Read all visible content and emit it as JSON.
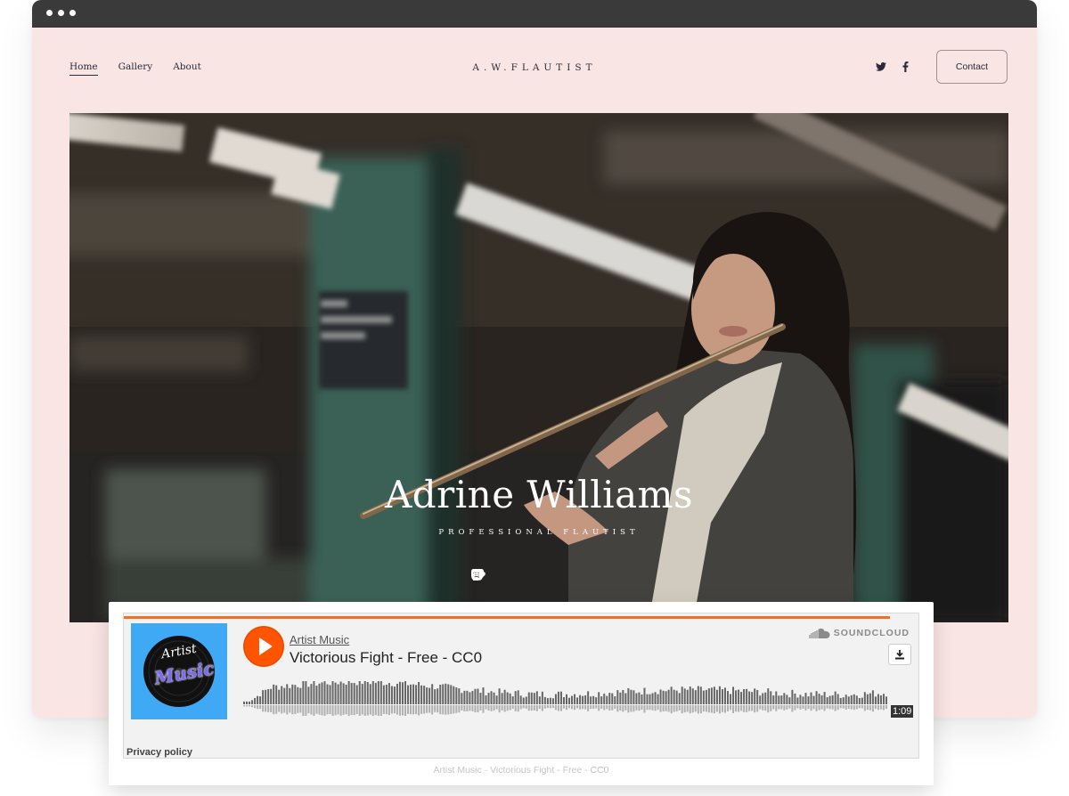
{
  "browser": {
    "dots": 3
  },
  "nav": {
    "items": [
      {
        "label": "Home"
      },
      {
        "label": "Gallery"
      },
      {
        "label": "About"
      }
    ]
  },
  "logo": "A.W.FLAUTIST",
  "header": {
    "contact_label": "Contact",
    "social_icons": [
      "twitter-icon",
      "facebook-icon"
    ]
  },
  "hero": {
    "title": "Adrine Williams",
    "subtitle": "PROFESSIONAL FLAUTIST",
    "social_icons": [
      "facebook-icon",
      "youtube-icon",
      "instagram-icon",
      "spotify-icon",
      "soundcloud-icon"
    ]
  },
  "player": {
    "artist": "Artist Music",
    "track": "Victorious Fight - Free - CC0",
    "brand": "SOUNDCLOUD",
    "duration": "1:09",
    "privacy": "Privacy policy",
    "art_line1": "Artist",
    "art_line2": "Music",
    "caption": "Artist Music · Victorious Fight - Free - CC0",
    "colors": {
      "accent": "#ff5500",
      "art_bg": "#3fa9f5"
    }
  },
  "colors": {
    "page_bg": "#f9e5e3",
    "chrome": "#3a3a3a"
  }
}
